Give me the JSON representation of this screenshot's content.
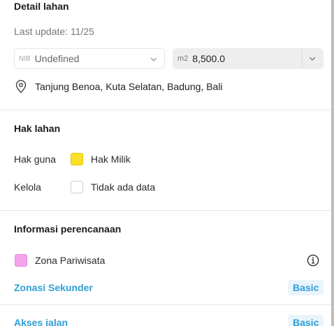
{
  "detail_lahan": {
    "title": "Detail lahan",
    "last_update": "Last update: 11/25",
    "nib": {
      "prefix": "NIB",
      "value": "Undefined"
    },
    "area": {
      "unit": "m2",
      "value": "8,500.0"
    },
    "location": "Tanjung Benoa, Kuta Selatan, Badung, Bali"
  },
  "hak_lahan": {
    "title": "Hak lahan",
    "rows": [
      {
        "label": "Hak guna",
        "value": "Hak Milik",
        "swatch_color": "#f9df2a"
      },
      {
        "label": "Kelola",
        "value": "Tidak ada data",
        "swatch_color": "#ffffff"
      }
    ]
  },
  "informasi_perencanaan": {
    "title": "Informasi perencanaan",
    "zona": {
      "label": "Zona Pariwisata",
      "swatch_color": "#f5a3ec"
    },
    "zonasi_sekunder": {
      "label": "Zonasi Sekunder",
      "badge": "Basic"
    },
    "akses_jalan": {
      "label": "Akses jalan",
      "badge": "Basic"
    }
  },
  "colors": {
    "accent": "#2f9fd6",
    "badge_bg": "#eaf4fb"
  },
  "icons": {
    "location": "map-pin-icon",
    "info": "info-circle-icon",
    "dropdown": "chevron-down-icon"
  }
}
